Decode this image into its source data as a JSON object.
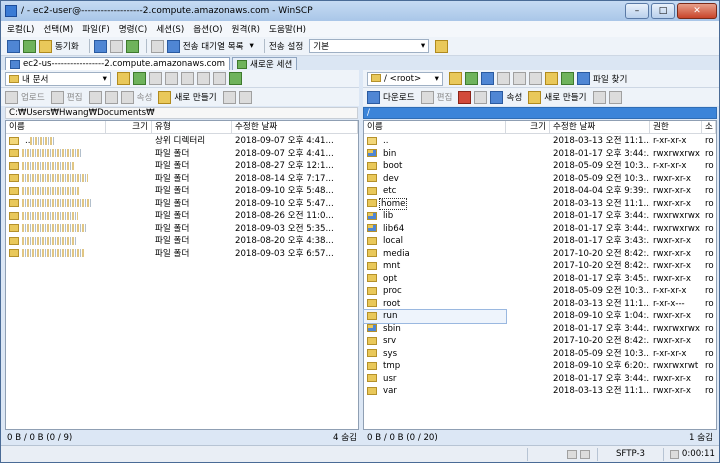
{
  "window": {
    "title": "/ - ec2-user@-------------------2.compute.amazonaws.com - WinSCP",
    "minimize": "–",
    "maximize": "□",
    "close": "✕"
  },
  "menu": [
    "로컬(L)",
    "선택(M)",
    "파일(F)",
    "명령(C)",
    "세션(S)",
    "옵션(O)",
    "원격(R)",
    "도움말(H)"
  ],
  "toolbar1": {
    "sync_label": "동기화",
    "queue_label": "전송 대기열 목록",
    "transfer_label": "전송 설정",
    "transfer_value": "기본"
  },
  "tabs": {
    "session": "ec2-us-----------------2.compute.amazonaws.com",
    "new_session": "새로운 세션"
  },
  "left": {
    "drive": "내 문서",
    "upload": "업로드",
    "edit": "편집",
    "properties": "속성",
    "new": "새로 만들기",
    "path": "C:₩Users₩Hwang₩Documents₩",
    "columns": {
      "name": "이름",
      "size": "크기",
      "type": "유형",
      "modified": "수정한 날짜"
    },
    "rows": [
      {
        "name": "..",
        "type": "상위 디렉터리",
        "modified": "2018-09-07  오후 4:41..."
      },
      {
        "name": "",
        "type": "파일 폴더",
        "modified": "2018-09-07  오후 4:41..."
      },
      {
        "name": "",
        "type": "파일 폴더",
        "modified": "2018-08-27  오후 12:1..."
      },
      {
        "name": "",
        "type": "파일 폴더",
        "modified": "2018-08-14  오후 7:17..."
      },
      {
        "name": "",
        "type": "파일 폴더",
        "modified": "2018-09-10  오후 5:48..."
      },
      {
        "name": "",
        "type": "파일 폴더",
        "modified": "2018-09-10  오후 5:47..."
      },
      {
        "name": "",
        "type": "파일 폴더",
        "modified": "2018-08-26  오전 11:0..."
      },
      {
        "name": "",
        "type": "파일 폴더",
        "modified": "2018-09-03  오전 5:35..."
      },
      {
        "name": "",
        "type": "파일 폴더",
        "modified": "2018-08-20  오후 4:38..."
      },
      {
        "name": "",
        "type": "파일 폴더",
        "modified": "2018-09-03  오후 6:57..."
      }
    ],
    "status_left": "0 B / 0 B (0 / 9)",
    "status_right": "4 숨김"
  },
  "right": {
    "dir": "/ <root>",
    "find": "파일 찾기",
    "download": "다운로드",
    "edit": "편집",
    "properties": "속성",
    "new": "새로 만들기",
    "path": "/",
    "columns": {
      "name": "이름",
      "size": "크기",
      "modified": "수정한 날짜",
      "rights": "권한",
      "owner": "소"
    },
    "rows": [
      {
        "name": "..",
        "modified": "2018-03-13  오전 11:1...",
        "rights": "r-xr-xr-x",
        "owner": "ro",
        "icon": "up"
      },
      {
        "name": "bin",
        "modified": "2018-01-17  오후 3:44:...",
        "rights": "rwxrwxrwx",
        "owner": "ro",
        "icon": "link"
      },
      {
        "name": "boot",
        "modified": "2018-05-09  오전 10:3...",
        "rights": "r-xr-xr-x",
        "owner": "ro",
        "icon": "f"
      },
      {
        "name": "dev",
        "modified": "2018-05-09  오전 10:3...",
        "rights": "rwxr-xr-x",
        "owner": "ro",
        "icon": "f"
      },
      {
        "name": "etc",
        "modified": "2018-04-04  오후 9:39:...",
        "rights": "rwxr-xr-x",
        "owner": "ro",
        "icon": "f"
      },
      {
        "name": "home",
        "modified": "2018-03-13  오전 11:1...",
        "rights": "rwxr-xr-x",
        "owner": "ro",
        "icon": "f"
      },
      {
        "name": "lib",
        "modified": "2018-01-17  오후 3:44:...",
        "rights": "rwxrwxrwx",
        "owner": "ro",
        "icon": "link"
      },
      {
        "name": "lib64",
        "modified": "2018-01-17  오후 3:44:...",
        "rights": "rwxrwxrwx",
        "owner": "ro",
        "icon": "link"
      },
      {
        "name": "local",
        "modified": "2018-01-17  오후 3:43:...",
        "rights": "rwxr-xr-x",
        "owner": "ro",
        "icon": "f"
      },
      {
        "name": "media",
        "modified": "2017-10-20  오전 8:42:...",
        "rights": "rwxr-xr-x",
        "owner": "ro",
        "icon": "f"
      },
      {
        "name": "mnt",
        "modified": "2017-10-20  오전 8:42:...",
        "rights": "rwxr-xr-x",
        "owner": "ro",
        "icon": "f"
      },
      {
        "name": "opt",
        "modified": "2018-01-17  오후 3:45:...",
        "rights": "rwxr-xr-x",
        "owner": "ro",
        "icon": "f"
      },
      {
        "name": "proc",
        "modified": "2018-05-09  오전 10:3...",
        "rights": "r-xr-xr-x",
        "owner": "ro",
        "icon": "f"
      },
      {
        "name": "root",
        "modified": "2018-03-13  오전 11:1...",
        "rights": "r-xr-x---",
        "owner": "ro",
        "icon": "f"
      },
      {
        "name": "run",
        "modified": "2018-09-10  오후 1:04:...",
        "rights": "rwxr-xr-x",
        "owner": "ro",
        "icon": "f"
      },
      {
        "name": "sbin",
        "modified": "2018-01-17  오후 3:44:...",
        "rights": "rwxrwxrwx",
        "owner": "ro",
        "icon": "link"
      },
      {
        "name": "srv",
        "modified": "2017-10-20  오전 8:42:...",
        "rights": "rwxr-xr-x",
        "owner": "ro",
        "icon": "f"
      },
      {
        "name": "sys",
        "modified": "2018-05-09  오전 10:3...",
        "rights": "r-xr-xr-x",
        "owner": "ro",
        "icon": "f"
      },
      {
        "name": "tmp",
        "modified": "2018-09-10  오후 6:20:...",
        "rights": "rwxrwxrwt",
        "owner": "ro",
        "icon": "f"
      },
      {
        "name": "usr",
        "modified": "2018-01-17  오후 3:44:...",
        "rights": "rwxr-xr-x",
        "owner": "ro",
        "icon": "f"
      },
      {
        "name": "var",
        "modified": "2018-03-13  오전 11:1...",
        "rights": "rwxr-xr-x",
        "owner": "ro",
        "icon": "f"
      }
    ],
    "status_left": "0 B / 0 B (0 / 20)",
    "status_right": "1 숨김"
  },
  "bottom": {
    "protocol": "SFTP-3",
    "time": "0:00:11"
  }
}
